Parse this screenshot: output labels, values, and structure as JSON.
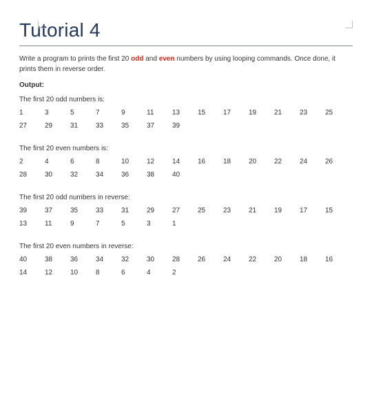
{
  "title": "Tutorial 4",
  "intro": {
    "part1": "Write a program to prints the first 20 ",
    "kw_odd": "odd",
    "part2": " and ",
    "kw_even": "even",
    "part3": " numbers by using looping commands. Once done, it prints them in reverse order."
  },
  "output_label": "Output:",
  "columns_per_row": 13,
  "sections": [
    {
      "title": "The first 20 odd numbers is:",
      "numbers": [
        1,
        3,
        5,
        7,
        9,
        11,
        13,
        15,
        17,
        19,
        21,
        23,
        25,
        27,
        29,
        31,
        33,
        35,
        37,
        39
      ]
    },
    {
      "title": "The first 20 even numbers is:",
      "numbers": [
        2,
        4,
        6,
        8,
        10,
        12,
        14,
        16,
        18,
        20,
        22,
        24,
        26,
        28,
        30,
        32,
        34,
        36,
        38,
        40
      ]
    },
    {
      "title": "The first 20 odd numbers in reverse:",
      "numbers": [
        39,
        37,
        35,
        33,
        31,
        29,
        27,
        25,
        23,
        21,
        19,
        17,
        15,
        13,
        11,
        9,
        7,
        5,
        3,
        1
      ]
    },
    {
      "title": "The first 20 even numbers in reverse:",
      "numbers": [
        40,
        38,
        36,
        34,
        32,
        30,
        28,
        26,
        24,
        22,
        20,
        18,
        16,
        14,
        12,
        10,
        8,
        6,
        4,
        2
      ]
    }
  ]
}
